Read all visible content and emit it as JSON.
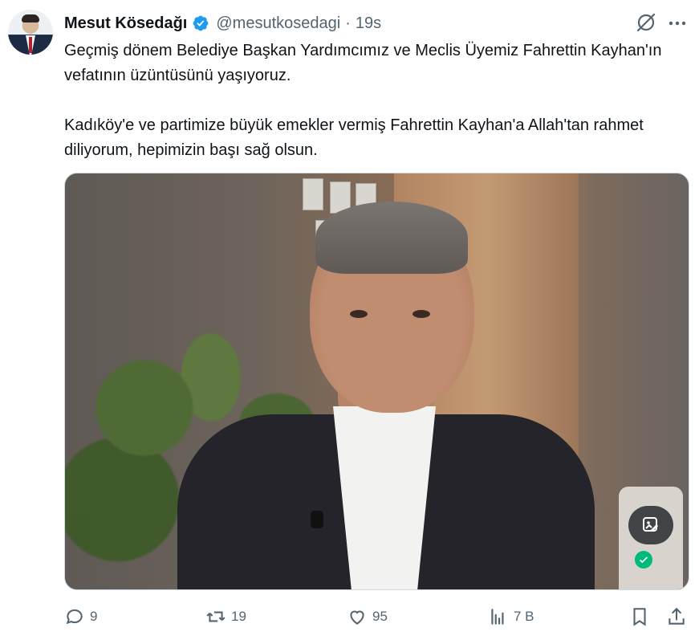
{
  "author": {
    "name": "Mesut Kösedağı",
    "handle": "@mesutkosedagi",
    "separator": "·",
    "time": "19s",
    "verified": true,
    "avatar_icon": "profile-photo"
  },
  "tweet": {
    "text": "Geçmiş dönem Belediye Başkan Yardımcımız ve Meclis Üyemiz Fahrettin Kayhan'ın vefatının üzüntüsünü yaşıyoruz.\n\nKadıköy'e ve partimize büyük emekler vermiş Fahrettin Kayhan'a Allah'tan rahmet diliyorum, hepimizin başı sağ olsun."
  },
  "header_icons": {
    "grok": "grok-icon",
    "more": "more-icon"
  },
  "media": {
    "type": "photo",
    "alt_button_icon": "image-edit-icon",
    "badge_icon": "checkmark-icon"
  },
  "actions": {
    "replies": "9",
    "reposts": "19",
    "likes": "95",
    "views": "7 B",
    "bookmark_icon": "bookmark-icon",
    "share_icon": "share-icon"
  },
  "colors": {
    "text": "#0f1419",
    "secondary": "#536471",
    "verified": "#1d9bf0",
    "badge": "#00ba7c",
    "border": "#cfd9de"
  }
}
